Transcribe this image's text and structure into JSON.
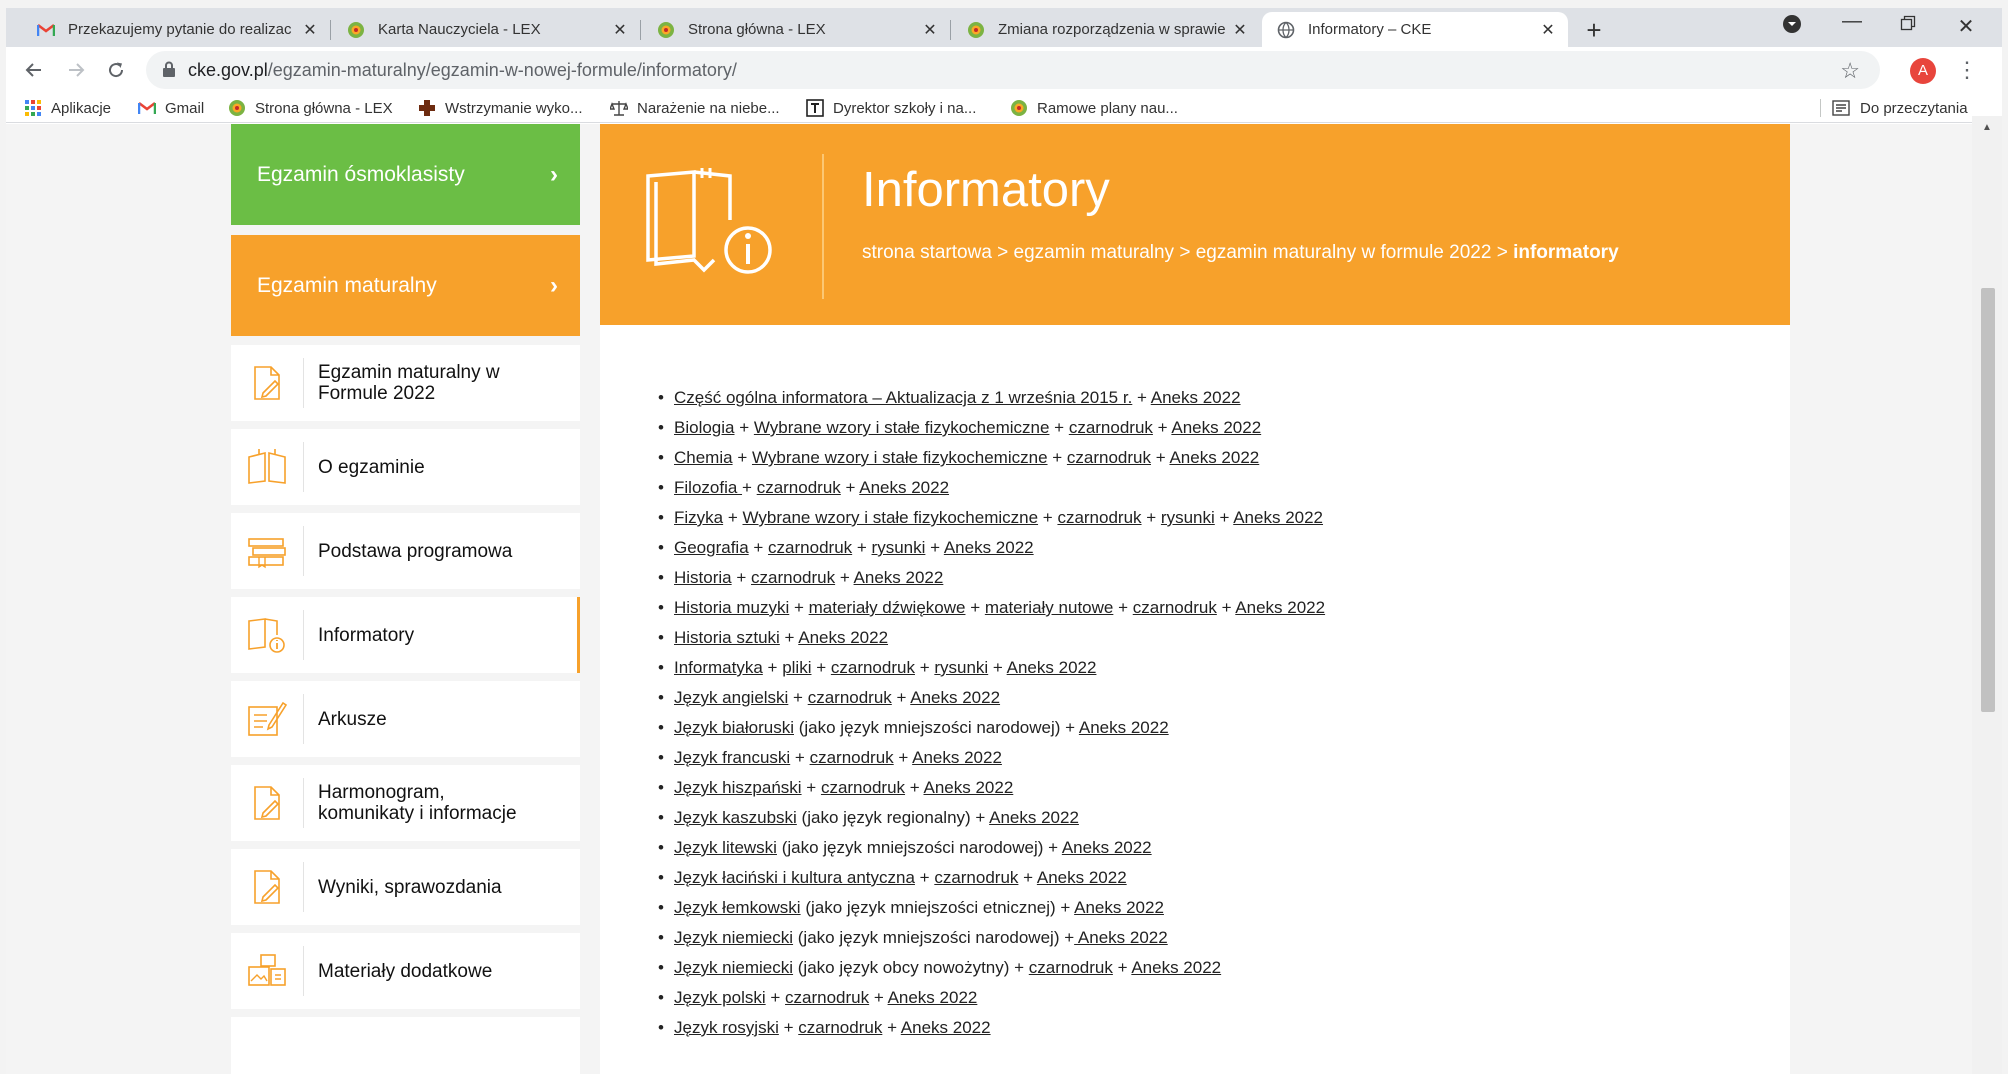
{
  "browser": {
    "tabs": [
      {
        "title": "Przekazujemy pytanie do realizac",
        "icon": "gmail-icon"
      },
      {
        "title": "Karta Nauczyciela - LEX",
        "icon": "lex-icon"
      },
      {
        "title": "Strona główna - LEX",
        "icon": "lex-icon"
      },
      {
        "title": "Zmiana rozporządzenia w sprawie",
        "icon": "lex-icon"
      },
      {
        "title": "Informatory – CKE",
        "icon": "globe-icon",
        "active": true
      }
    ],
    "url_host": "cke.gov.pl",
    "url_path": "/egzamin-maturalny/egzamin-w-nowej-formule/informatory/",
    "profile_initial": "A",
    "bookmarks": [
      {
        "label": "Aplikacje",
        "icon": "apps-grid-icon"
      },
      {
        "label": "Gmail",
        "icon": "gmail-icon"
      },
      {
        "label": "Strona główna - LEX",
        "icon": "lex-icon"
      },
      {
        "label": "Wstrzymanie wyko...",
        "icon": "cross-icon"
      },
      {
        "label": "Narażenie na niebe...",
        "icon": "scales-icon"
      },
      {
        "label": "Dyrektor szkoły i na...",
        "icon": "t-icon"
      },
      {
        "label": "Ramowe plany nau...",
        "icon": "lex-icon"
      }
    ],
    "reading_list": "Do przeczytania"
  },
  "sidebar": {
    "primary": [
      {
        "label": "Egzamin ósmoklasisty",
        "color": "#6bbe45"
      },
      {
        "label": "Egzamin maturalny",
        "color": "#f7a12b"
      }
    ],
    "items": [
      {
        "label": "Egzamin maturalny w Formule 2022",
        "icon": "document-pencil-icon"
      },
      {
        "label": "O egzaminie",
        "icon": "open-book-icon"
      },
      {
        "label": "Podstawa programowa",
        "icon": "books-stack-icon"
      },
      {
        "label": "Informatory",
        "icon": "book-info-icon",
        "active": true
      },
      {
        "label": "Arkusze",
        "icon": "sheet-pencil-icon"
      },
      {
        "label": "Harmonogram, komunikaty i informacje",
        "icon": "document-pencil-icon"
      },
      {
        "label": "Wyniki, sprawozdania",
        "icon": "document-pencil-icon"
      },
      {
        "label": "Materiały dodatkowe",
        "icon": "media-files-icon"
      }
    ]
  },
  "banner": {
    "title": "Informatory",
    "breadcrumb_prefix": "strona startowa > egzamin maturalny > egzamin maturalny w formule 2022 > ",
    "breadcrumb_current": "informatory",
    "accent": "#f7a12b"
  },
  "informatory": [
    [
      {
        "t": "Część ogólna informatora – Aktualizacja z 1 września 2015 r.",
        "l": true
      },
      {
        "t": " + "
      },
      {
        "t": "Aneks 2022",
        "l": true
      }
    ],
    [
      {
        "t": "Biologia",
        "l": true
      },
      {
        "t": " + "
      },
      {
        "t": "Wybrane wzory i stałe fizykochemiczne",
        "l": true
      },
      {
        "t": " + "
      },
      {
        "t": "czarnodruk",
        "l": true
      },
      {
        "t": " + "
      },
      {
        "t": "Aneks 2022",
        "l": true
      }
    ],
    [
      {
        "t": "Chemia",
        "l": true
      },
      {
        "t": " + "
      },
      {
        "t": "Wybrane wzory i stałe fizykochemiczne",
        "l": true
      },
      {
        "t": " + "
      },
      {
        "t": "czarnodruk",
        "l": true
      },
      {
        "t": " + "
      },
      {
        "t": "Aneks 2022",
        "l": true
      }
    ],
    [
      {
        "t": "Filozofia ",
        "l": true
      },
      {
        "t": "+ "
      },
      {
        "t": "czarnodruk",
        "l": true
      },
      {
        "t": " + "
      },
      {
        "t": "Aneks 2022",
        "l": true
      }
    ],
    [
      {
        "t": "Fizyka",
        "l": true
      },
      {
        "t": " + "
      },
      {
        "t": "Wybrane wzory i stałe fizykochemiczne",
        "l": true
      },
      {
        "t": " + "
      },
      {
        "t": "czarnodruk",
        "l": true
      },
      {
        "t": " + "
      },
      {
        "t": "rysunki",
        "l": true
      },
      {
        "t": " + "
      },
      {
        "t": "Aneks 2022",
        "l": true
      }
    ],
    [
      {
        "t": "Geografia",
        "l": true
      },
      {
        "t": " + "
      },
      {
        "t": "czarnodruk",
        "l": true
      },
      {
        "t": " + "
      },
      {
        "t": "rysunki",
        "l": true
      },
      {
        "t": " + "
      },
      {
        "t": "Aneks 2022",
        "l": true
      }
    ],
    [
      {
        "t": "Historia",
        "l": true
      },
      {
        "t": " + "
      },
      {
        "t": "czarnodruk",
        "l": true
      },
      {
        "t": " + "
      },
      {
        "t": "Aneks 2022",
        "l": true
      }
    ],
    [
      {
        "t": "Historia muzyki",
        "l": true
      },
      {
        "t": " + "
      },
      {
        "t": "materiały dźwiękowe",
        "l": true
      },
      {
        "t": " + "
      },
      {
        "t": "materiały nutowe",
        "l": true
      },
      {
        "t": " + "
      },
      {
        "t": "czarnodruk",
        "l": true
      },
      {
        "t": " + "
      },
      {
        "t": "Aneks 2022",
        "l": true
      }
    ],
    [
      {
        "t": "Historia sztuki",
        "l": true
      },
      {
        "t": " + "
      },
      {
        "t": "Aneks 2022",
        "l": true
      }
    ],
    [
      {
        "t": "Informatyka",
        "l": true
      },
      {
        "t": " + "
      },
      {
        "t": "pliki",
        "l": true
      },
      {
        "t": " + "
      },
      {
        "t": "czarnodruk",
        "l": true
      },
      {
        "t": " + "
      },
      {
        "t": "rysunki",
        "l": true
      },
      {
        "t": " + "
      },
      {
        "t": "Aneks 2022",
        "l": true
      }
    ],
    [
      {
        "t": "Język angielski",
        "l": true
      },
      {
        "t": " + "
      },
      {
        "t": "czarnodruk",
        "l": true
      },
      {
        "t": " + "
      },
      {
        "t": "Aneks 2022",
        "l": true
      }
    ],
    [
      {
        "t": "Język białoruski",
        "l": true
      },
      {
        "t": " (jako język mniejszości narodowej) + "
      },
      {
        "t": "Aneks 2022",
        "l": true
      }
    ],
    [
      {
        "t": "Język francuski",
        "l": true
      },
      {
        "t": " + "
      },
      {
        "t": "czarnodruk",
        "l": true
      },
      {
        "t": " + "
      },
      {
        "t": "Aneks 2022",
        "l": true
      }
    ],
    [
      {
        "t": "Język hiszpański",
        "l": true
      },
      {
        "t": " + "
      },
      {
        "t": "czarnodruk",
        "l": true
      },
      {
        "t": " + "
      },
      {
        "t": "Aneks 2022",
        "l": true
      }
    ],
    [
      {
        "t": "Język kaszubski",
        "l": true
      },
      {
        "t": " (jako język regionalny) + "
      },
      {
        "t": "Aneks 2022",
        "l": true
      }
    ],
    [
      {
        "t": "Język litewski",
        "l": true
      },
      {
        "t": " (jako język mniejszości narodowej) + "
      },
      {
        "t": "Aneks 2022",
        "l": true
      }
    ],
    [
      {
        "t": "Język łaciński i kultura antyczna",
        "l": true
      },
      {
        "t": " + "
      },
      {
        "t": "czarnodruk",
        "l": true
      },
      {
        "t": " + "
      },
      {
        "t": "Aneks 2022",
        "l": true
      }
    ],
    [
      {
        "t": "Język łemkowski",
        "l": true
      },
      {
        "t": " (jako język mniejszości etnicznej) + "
      },
      {
        "t": "Aneks 2022",
        "l": true
      }
    ],
    [
      {
        "t": "Język niemiecki",
        "l": true
      },
      {
        "t": " (jako język mniejszości narodowej) +"
      },
      {
        "t": " Aneks 2022",
        "l": true
      }
    ],
    [
      {
        "t": "Język niemiecki",
        "l": true
      },
      {
        "t": " (jako język obcy nowożytny) + "
      },
      {
        "t": "czarnodruk",
        "l": true
      },
      {
        "t": " + "
      },
      {
        "t": "Aneks 2022",
        "l": true
      }
    ],
    [
      {
        "t": "Język polski",
        "l": true
      },
      {
        "t": " + "
      },
      {
        "t": "czarnodruk",
        "l": true
      },
      {
        "t": " + "
      },
      {
        "t": "Aneks 2022",
        "l": true
      }
    ],
    [
      {
        "t": "Język rosyjski",
        "l": true
      },
      {
        "t": " + "
      },
      {
        "t": "czarnodruk",
        "l": true
      },
      {
        "t": " + "
      },
      {
        "t": "Aneks 2022",
        "l": true
      }
    ]
  ]
}
